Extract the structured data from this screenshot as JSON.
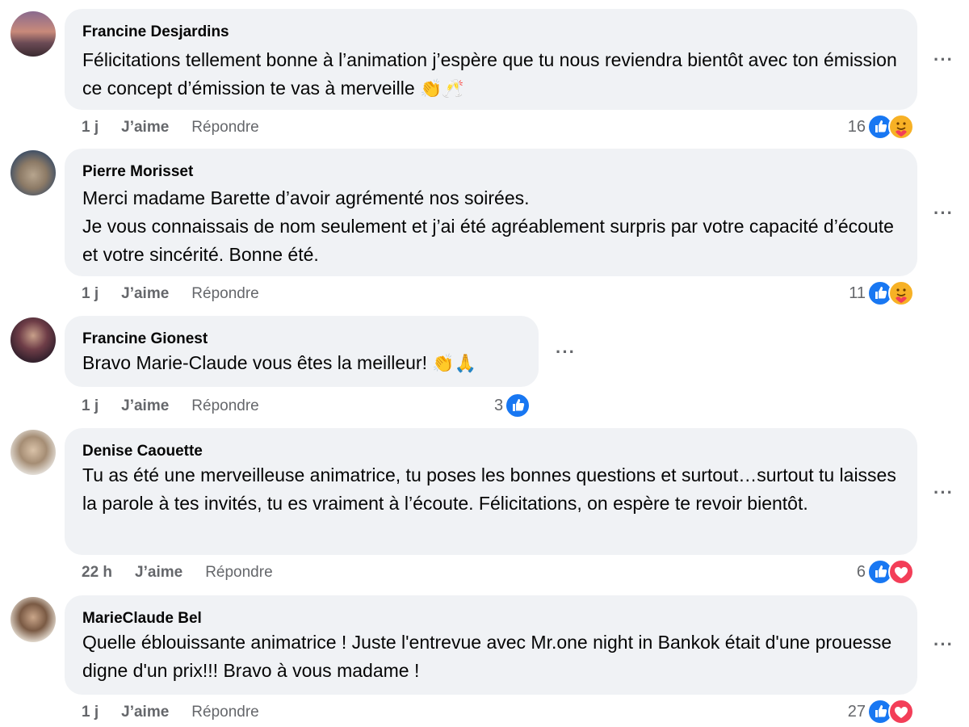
{
  "labels": {
    "like": "J’aime",
    "reply": "Répondre",
    "more": "···"
  },
  "comments": [
    {
      "author": "Francine Desjardins",
      "paragraphs": [
        "Félicitations tellement bonne à l’animation j’espère que tu nous reviendra bientôt avec ton émission ce concept d’émission te vas à merveille"
      ],
      "emojis": "👏🥂",
      "time": "1 j",
      "count": "16",
      "reactions": [
        "like-icon",
        "care-icon"
      ]
    },
    {
      "author": "Pierre Morisset",
      "paragraphs": [
        "Merci madame Barette d’avoir agrémenté nos soirées.",
        "Je vous connaissais de nom seulement et j’ai été agréablement surpris par votre capacité d’écoute et votre sincérité. Bonne été."
      ],
      "emojis": "",
      "time": "1 j",
      "count": "11",
      "reactions": [
        "like-icon",
        "care-icon"
      ]
    },
    {
      "author": "Francine Gionest",
      "paragraphs": [
        "Bravo Marie-Claude vous êtes la meilleur!"
      ],
      "emojis": "👏🙏",
      "time": "1 j",
      "count": "3",
      "reactions": [
        "like-icon"
      ]
    },
    {
      "author": "Denise Caouette",
      "paragraphs": [
        "Tu as été une merveilleuse animatrice, tu poses les bonnes questions et surtout…surtout tu laisses la parole à tes invités, tu es vraiment à l’écoute. Félicitations, on espère te revoir bientôt."
      ],
      "emojis": "",
      "time": "22 h",
      "count": "6",
      "reactions": [
        "like-icon",
        "love-icon"
      ]
    },
    {
      "author": "MarieClaude Bel",
      "paragraphs": [
        "Quelle éblouissante animatrice ! Juste l'entrevue avec Mr.one night in Bankok était d'une prouesse digne d'un prix!!! Bravo à vous madame !"
      ],
      "emojis": "",
      "time": "1 j",
      "count": "27",
      "reactions": [
        "like-icon",
        "love-icon"
      ]
    }
  ],
  "colors": {
    "bubble": "#f0f2f5",
    "meta": "#65676b",
    "like": "#1877f2",
    "love": "#f33e58",
    "care": "#f7b125"
  }
}
